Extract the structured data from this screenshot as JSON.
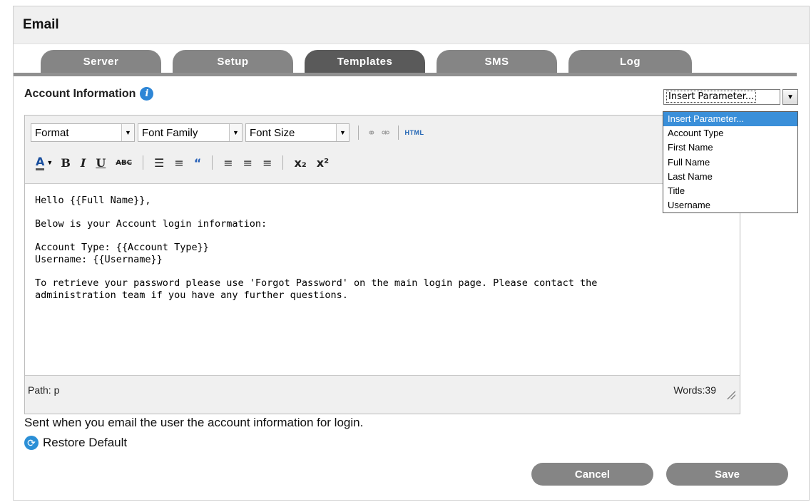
{
  "header": {
    "title": "Email"
  },
  "tabs": [
    {
      "label": "Server"
    },
    {
      "label": "Setup"
    },
    {
      "label": "Templates"
    },
    {
      "label": "SMS"
    },
    {
      "label": "Log"
    }
  ],
  "active_tab": "Templates",
  "section": {
    "title": "Account Information"
  },
  "insert_parameter": {
    "selected": "Insert Parameter...",
    "options": [
      "Insert Parameter...",
      "Account Type",
      "First Name",
      "Full Name",
      "Last Name",
      "Title",
      "Username"
    ]
  },
  "toolbar": {
    "format": "Format",
    "font_family": "Font Family",
    "font_size": "Font Size",
    "html": "HTML"
  },
  "content": {
    "lines": [
      "Hello {{Full Name}},",
      "Below is your Account login information:",
      "Account Type: {{Account Type}}",
      "Username: {{Username}}",
      "To retrieve your password please use 'Forgot Password' on the main login page. Please contact the",
      "administration team if you have any further questions."
    ]
  },
  "status": {
    "path": "Path: p",
    "words": "Words:39"
  },
  "description": "Sent when you email the user the account information for login.",
  "restore_label": "Restore Default",
  "buttons": {
    "cancel": "Cancel",
    "save": "Save"
  }
}
